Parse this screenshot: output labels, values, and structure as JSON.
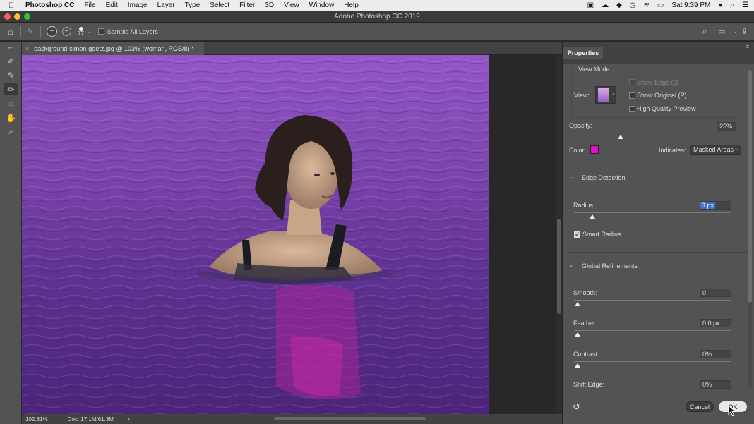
{
  "menubar": {
    "app_name": "Photoshop CC",
    "items": [
      "File",
      "Edit",
      "Image",
      "Layer",
      "Type",
      "Select",
      "Filter",
      "3D",
      "View",
      "Window",
      "Help"
    ],
    "clock": "Sat 9:39 PM"
  },
  "window": {
    "title": "Adobe Photoshop CC 2019"
  },
  "options_bar": {
    "brush_size": "77",
    "sample_all_layers_label": "Sample All Layers",
    "sample_all_layers_checked": false
  },
  "document": {
    "tab_title": "background-simon-goetz.jpg @ 103% (woman, RGB/8) *",
    "zoom": "102.81%",
    "doc_size": "Doc: 17.1M/61.3M"
  },
  "properties": {
    "tab_label": "Properties",
    "view_mode": {
      "header": "View Mode",
      "view_label": "View:",
      "show_edge_label": "Show Edge (J)",
      "show_original_label": "Show Original (P)",
      "high_quality_label": "High Quality Preview"
    },
    "opacity": {
      "label": "Opacity:",
      "value": "25%",
      "level": 0.25
    },
    "color": {
      "label": "Color:",
      "swatch": "#e60fcf"
    },
    "indicates": {
      "label": "Indicates:",
      "value": "Masked Areas"
    },
    "edge_detection": {
      "header": "Edge Detection",
      "radius_label": "Radius:",
      "radius_value": "3 px",
      "radius_level": 0.015,
      "smart_radius_label": "Smart Radius",
      "smart_radius_checked": true
    },
    "global_refinements": {
      "header": "Global Refinements",
      "smooth_label": "Smooth:",
      "smooth_value": "0",
      "feather_label": "Feather:",
      "feather_value": "0.0 px",
      "contrast_label": "Contrast:",
      "contrast_value": "0%",
      "shift_edge_label": "Shift Edge:",
      "shift_edge_value": "0%"
    },
    "cancel_label": "Cancel",
    "ok_label": "OK"
  },
  "colors": {
    "overlay_purple": "#8a4cc0",
    "mask_color": "#e60fcf"
  }
}
